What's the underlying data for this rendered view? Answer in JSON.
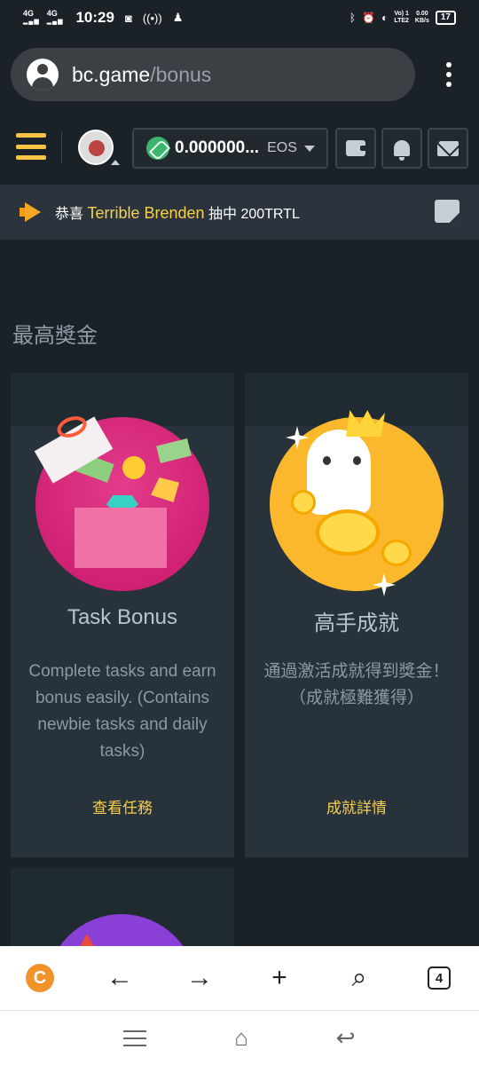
{
  "status_bar": {
    "signal1": "4G",
    "signal2": "4G",
    "time": "10:29",
    "volte": "Vo) 1",
    "lte": "LTE2",
    "speed_value": "0.00",
    "speed_unit": "KB/s",
    "battery": "17"
  },
  "browser": {
    "url_host": "bc.game",
    "url_path": "/bonus"
  },
  "header": {
    "balance_value": "0.000000...",
    "balance_currency": "EOS"
  },
  "ticker": {
    "prefix": "恭喜",
    "user_name": "Terrible Brenden",
    "suffix": "抽中 200TRTL"
  },
  "section": {
    "title": "最高獎金"
  },
  "cards": [
    {
      "title": "Task Bonus",
      "description": "Complete tasks and earn bonus easily. (Contains newbie tasks and daily tasks)",
      "link": "查看任務"
    },
    {
      "title": "高手成就",
      "description": "通過激活成就得到獎金！（成就極難獲得）",
      "link": "成就詳情"
    }
  ],
  "bottom_bar": {
    "tabs_count": "4",
    "logo_letter": "C"
  },
  "colors": {
    "accent": "#f6d04d",
    "background": "#1a2127",
    "card": "#27323b"
  }
}
